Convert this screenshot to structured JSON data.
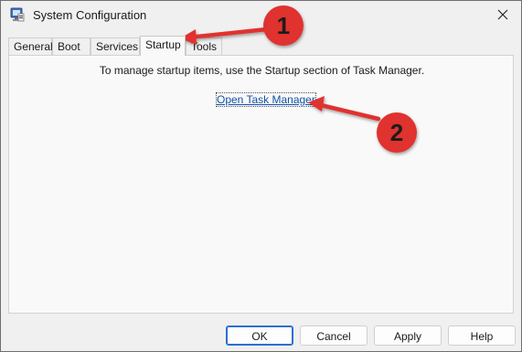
{
  "window": {
    "title": "System Configuration"
  },
  "tabs": [
    {
      "label": "General"
    },
    {
      "label": "Boot"
    },
    {
      "label": "Services"
    },
    {
      "label": "Startup",
      "active": true
    },
    {
      "label": "Tools"
    }
  ],
  "startup": {
    "message": "To manage startup items, use the Startup section of Task Manager.",
    "link_label": "Open Task Manager"
  },
  "buttons": {
    "ok": "OK",
    "cancel": "Cancel",
    "apply": "Apply",
    "help": "Help"
  },
  "annotations": {
    "marker_1": "1",
    "marker_2": "2",
    "color": "#e0312f"
  },
  "icons": {
    "app": "system-configuration-icon",
    "close": "close-icon"
  }
}
